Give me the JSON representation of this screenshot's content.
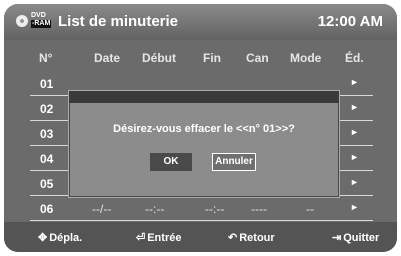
{
  "header": {
    "badge_top": "DVD",
    "badge_bottom": "-RAM",
    "title": "List de minuterie",
    "clock": "12:00 AM"
  },
  "columns": [
    "N°",
    "Date",
    "Début",
    "Fin",
    "Can",
    "Mode",
    "Éd."
  ],
  "rows": [
    {
      "num": "01"
    },
    {
      "num": "02"
    },
    {
      "num": "03"
    },
    {
      "num": "04"
    },
    {
      "num": "05"
    },
    {
      "num": "06",
      "date": "--/--",
      "start": "--:--",
      "end": "--:--",
      "channel": "----",
      "mode": "--"
    }
  ],
  "row_arrow": "►",
  "dialog": {
    "message": "Désirez-vous effacer le <<n° 01>>?",
    "ok": "OK",
    "cancel": "Annuler"
  },
  "footer": [
    {
      "icon": "dpad-icon",
      "glyph": "✥",
      "label": "Dépla."
    },
    {
      "icon": "enter-icon",
      "glyph": "⏎",
      "label": "Entrée"
    },
    {
      "icon": "return-icon",
      "glyph": "↶",
      "label": "Retour"
    },
    {
      "icon": "exit-icon",
      "glyph": "⇥",
      "label": "Quitter"
    }
  ]
}
